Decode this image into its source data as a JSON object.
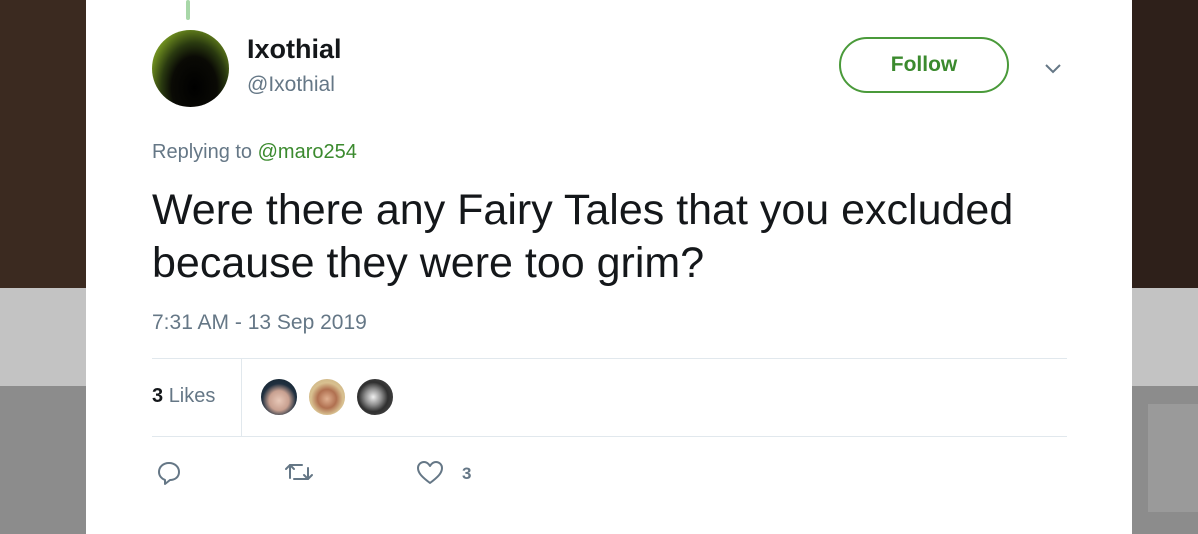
{
  "tweet": {
    "author_name": "Ixothial",
    "author_handle": "@Ixothial",
    "follow_label": "Follow",
    "replying_to_prefix": "Replying to",
    "replying_to_handle": "@maro254",
    "text": "Were there any Fairy Tales that you excluded because they were too grim?",
    "timestamp": "7:31 AM - 13 Sep 2019",
    "likes_count": "3",
    "likes_label": "Likes",
    "like_action_count": "3"
  },
  "icons": {
    "menu": "chevron-down-icon",
    "reply": "reply-icon",
    "retweet": "retweet-icon",
    "like": "heart-icon"
  },
  "colors": {
    "accent": "#3b8a2e",
    "secondary_text": "#657786",
    "primary_text": "#14171a"
  }
}
